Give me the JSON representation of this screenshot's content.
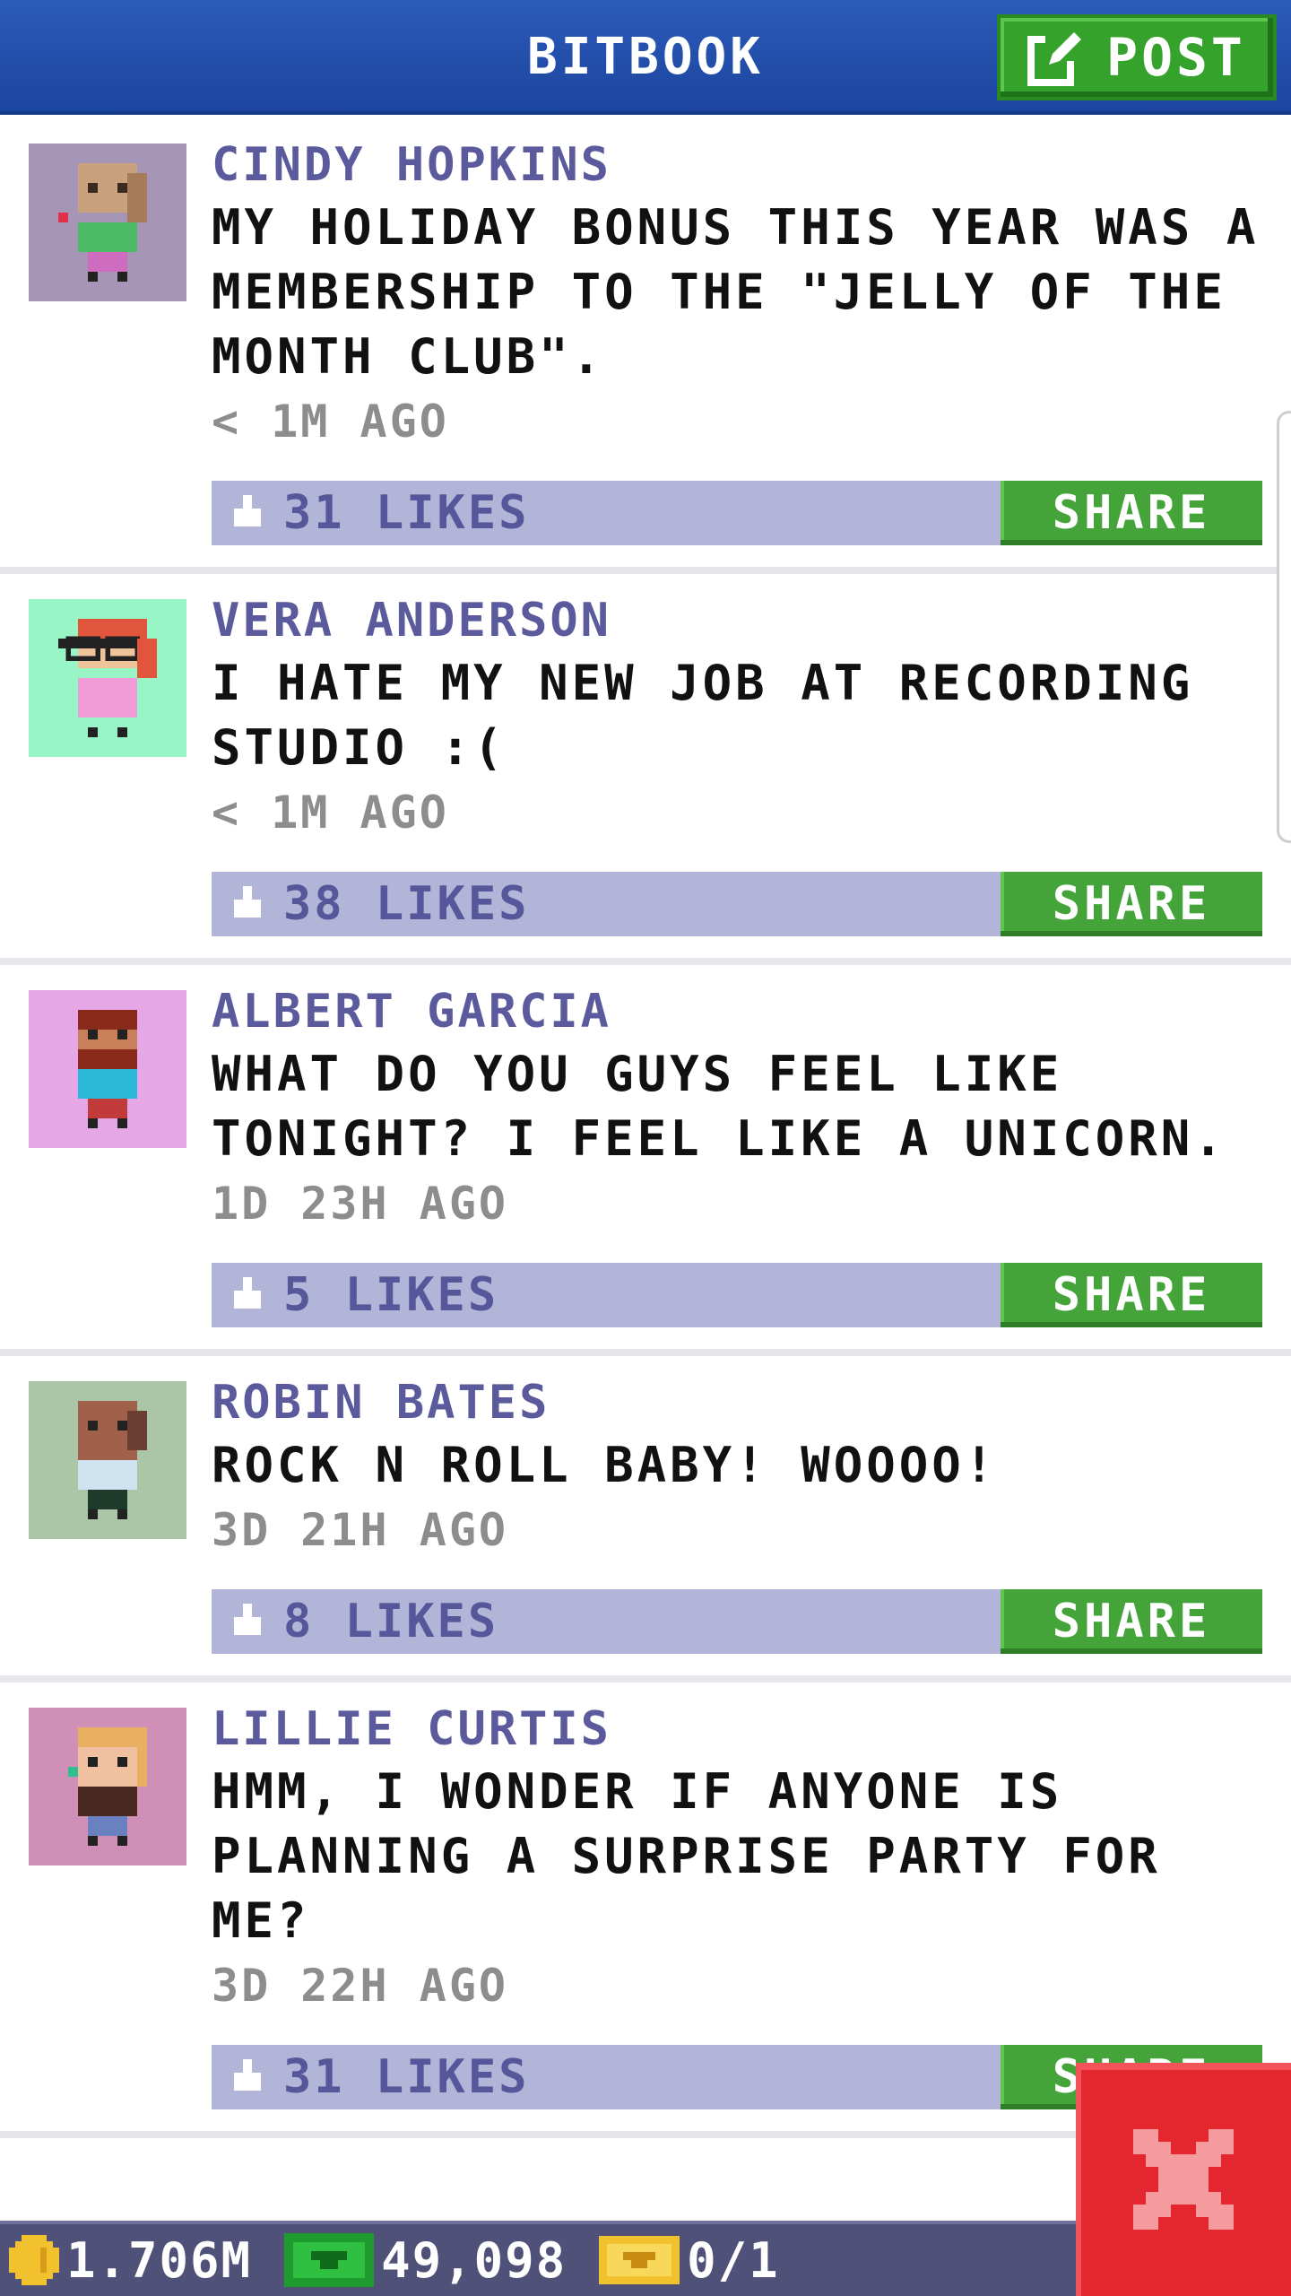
{
  "header": {
    "title": "BITBOOK",
    "post_label": "POST"
  },
  "share_label": "SHARE",
  "posts": [
    {
      "name": "CINDY HOPKINS",
      "text": "MY HOLIDAY BONUS THIS YEAR WAS A MEMBERSHIP TO THE \"JELLY OF THE MONTH CLUB\".",
      "time": "< 1M AGO",
      "likes": "31 LIKES",
      "avatar_bg": "#a695b7"
    },
    {
      "name": "VERA ANDERSON",
      "text": "I HATE MY NEW JOB AT RECORDING STUDIO :(",
      "time": "< 1M AGO",
      "likes": "38 LIKES",
      "avatar_bg": "#98f5c5"
    },
    {
      "name": "ALBERT GARCIA",
      "text": "WHAT DO YOU GUYS FEEL LIKE TONIGHT? I FEEL LIKE A UNICORN.",
      "time": "1D 23H AGO",
      "likes": "5 LIKES",
      "avatar_bg": "#e6a7e6"
    },
    {
      "name": "ROBIN BATES",
      "text": "ROCK N ROLL BABY! WOOOO!",
      "time": "3D 21H AGO",
      "likes": "8 LIKES",
      "avatar_bg": "#aac6a6"
    },
    {
      "name": "LILLIE CURTIS",
      "text": "HMM, I WONDER IF ANYONE IS PLANNING A SURPRISE PARTY FOR ME?",
      "time": "3D 22H AGO",
      "likes": "31 LIKES",
      "avatar_bg": "#cf8fb7"
    }
  ],
  "footer": {
    "coins": "1.706M",
    "bux": "49,098",
    "vip": "0/1"
  },
  "colors": {
    "header": "#1f4ea8",
    "post_button": "#35a22c",
    "like_bar": "#b3b5d8",
    "share_button": "#44a43a",
    "footer": "#4f5178",
    "close": "#e4262f"
  },
  "icons": [
    "edit-icon",
    "thumbs-up-icon",
    "coin-icon",
    "bux-icon",
    "ticket-icon",
    "close-icon"
  ]
}
